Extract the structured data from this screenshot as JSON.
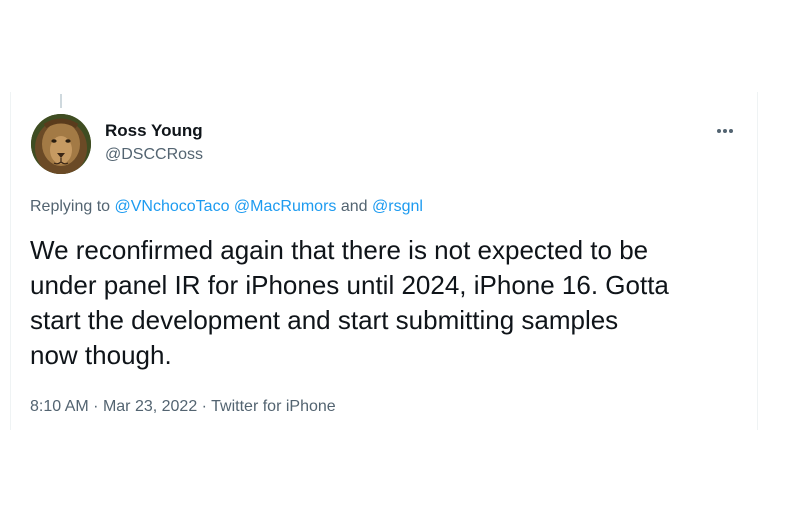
{
  "tweet": {
    "author": {
      "display_name": "Ross Young",
      "handle": "@DSCCRoss",
      "avatar_icon": "lion-avatar"
    },
    "more_icon": "more-horizontal-icon",
    "reply": {
      "prefix": "Replying to",
      "mentions": [
        "@VNchocoTaco",
        "@MacRumors"
      ],
      "conjunction": "and",
      "last_mention": "@rsgnl"
    },
    "text": "We reconfirmed again that there is not expected to be\nunder panel IR for iPhones until 2024, iPhone 16. Gotta\nstart the development and start submitting samples\nnow though.",
    "time": "8:10 AM",
    "separator": "·",
    "date": "Mar 23, 2022",
    "source": "Twitter for iPhone"
  },
  "colors": {
    "text_primary": "#0f1419",
    "text_secondary": "#536471",
    "link": "#1d9bf0",
    "border": "#eff3f4"
  }
}
